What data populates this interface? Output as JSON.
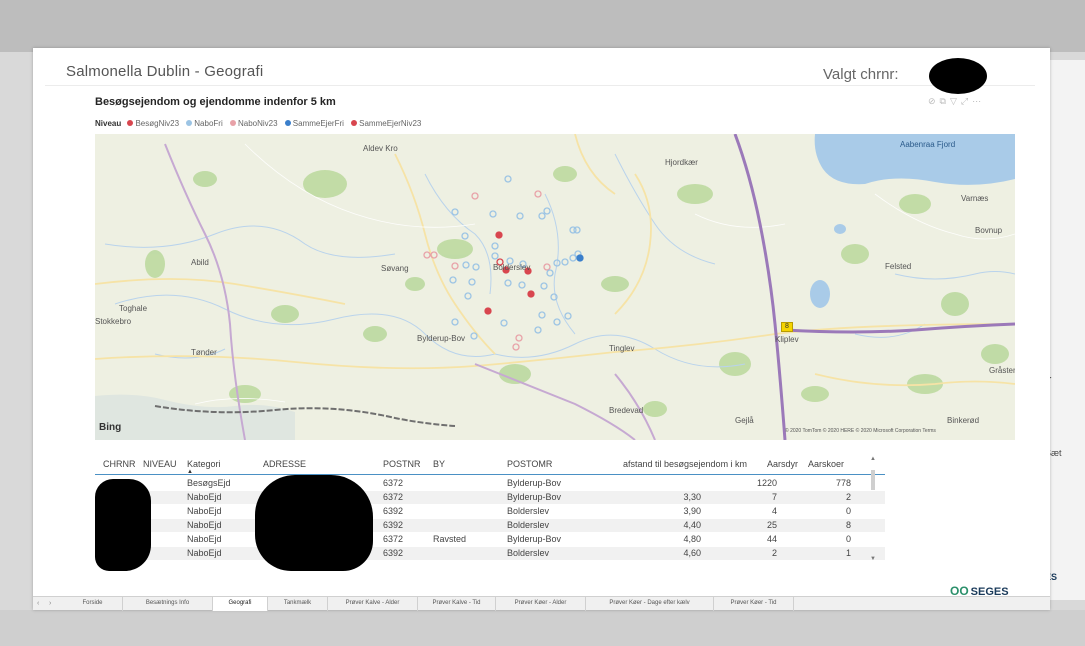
{
  "report": {
    "title": "Salmonella Dublin - Geografi",
    "selected_label": "Valgt chrnr:"
  },
  "visual": {
    "title": "Besøgsejendom og ejendomme indenfor 5 km",
    "icons": [
      "pin-icon",
      "copy-icon",
      "filter-icon",
      "focus-mode-icon",
      "more-options-icon"
    ]
  },
  "legend": {
    "title": "Niveau",
    "items": [
      {
        "label": "BesøgNiv23",
        "color": "#d8464f"
      },
      {
        "label": "NaboFri",
        "color": "#9cc4e4"
      },
      {
        "label": "NaboNiv23",
        "color": "#e8a2a8"
      },
      {
        "label": "SammeEjerFri",
        "color": "#3a7fcb"
      },
      {
        "label": "SammeEjerNiv23",
        "color": "#d8464f"
      }
    ]
  },
  "map": {
    "places": [
      {
        "name": "Aldev Kro"
      },
      {
        "name": "Hjordkær"
      },
      {
        "name": "Aabenraa Fjord"
      },
      {
        "name": "Varnæs"
      },
      {
        "name": "Bovnup"
      },
      {
        "name": "Abild"
      },
      {
        "name": "Søvang"
      },
      {
        "name": "Bolderslev"
      },
      {
        "name": "Felsted"
      },
      {
        "name": "Toghale"
      },
      {
        "name": "Stokkebro"
      },
      {
        "name": "Tønder"
      },
      {
        "name": "Bylderup-Bov"
      },
      {
        "name": "Tinglev"
      },
      {
        "name": "Kliplev"
      },
      {
        "name": "Gråsten"
      },
      {
        "name": "Bredevad"
      },
      {
        "name": "Gejlå"
      },
      {
        "name": "Binkerød"
      }
    ],
    "road_number": "8",
    "logo": "Bing",
    "attribution": "© 2020 TomTom © 2020 HERE © 2020 Microsoft Corporation Terms"
  },
  "table": {
    "columns": [
      "CHRNR",
      "NIVEAU",
      "Kategori",
      "ADRESSE",
      "POSTNR",
      "BY",
      "POSTOMR",
      "afstand til besøgsejendom i km",
      "Aarsdyr",
      "Aarskoer"
    ],
    "rows": [
      {
        "kategori": "BesøgsEjd",
        "postnr": "6372",
        "by": "",
        "postomr": "Bylderup-Bov",
        "afstand": "",
        "aarsdyr": "1220",
        "aarskoer": "778"
      },
      {
        "kategori": "NaboEjd",
        "postnr": "6372",
        "by": "",
        "postomr": "Bylderup-Bov",
        "afstand": "3,30",
        "aarsdyr": "7",
        "aarskoer": "2"
      },
      {
        "kategori": "NaboEjd",
        "postnr": "6392",
        "by": "",
        "postomr": "Bolderslev",
        "afstand": "3,90",
        "aarsdyr": "4",
        "aarskoer": "0"
      },
      {
        "kategori": "NaboEjd",
        "postnr": "6392",
        "by": "",
        "postomr": "Bolderslev",
        "afstand": "4,40",
        "aarsdyr": "25",
        "aarskoer": "8"
      },
      {
        "kategori": "NaboEjd",
        "postnr": "6372",
        "by": "Ravsted",
        "postomr": "Bylderup-Bov",
        "afstand": "4,80",
        "aarsdyr": "44",
        "aarskoer": "0"
      },
      {
        "kategori": "NaboEjd",
        "postnr": "6392",
        "by": "",
        "postomr": "Bolderslev",
        "afstand": "4,60",
        "aarsdyr": "2",
        "aarskoer": "1"
      }
    ]
  },
  "brand": {
    "name": "SEGES",
    "mark": "OO"
  },
  "tabs": [
    {
      "label": "Forside",
      "active": false
    },
    {
      "label": "Besætnings Info",
      "active": false
    },
    {
      "label": "Geografi",
      "active": true
    },
    {
      "label": "Tankmælk",
      "active": false
    },
    {
      "label": "Prøver Kalve - Alder",
      "active": false
    },
    {
      "label": "Prøver Kalve - Tid",
      "active": false
    },
    {
      "label": "Prøver Køer - Alder",
      "active": false
    },
    {
      "label": "Prøver Køer - Dage efter kælv",
      "active": false
    },
    {
      "label": "Prøver Køer - Tid",
      "active": false
    }
  ],
  "side_panel": {
    "labels": [
      "Sæt",
      "ES"
    ]
  }
}
